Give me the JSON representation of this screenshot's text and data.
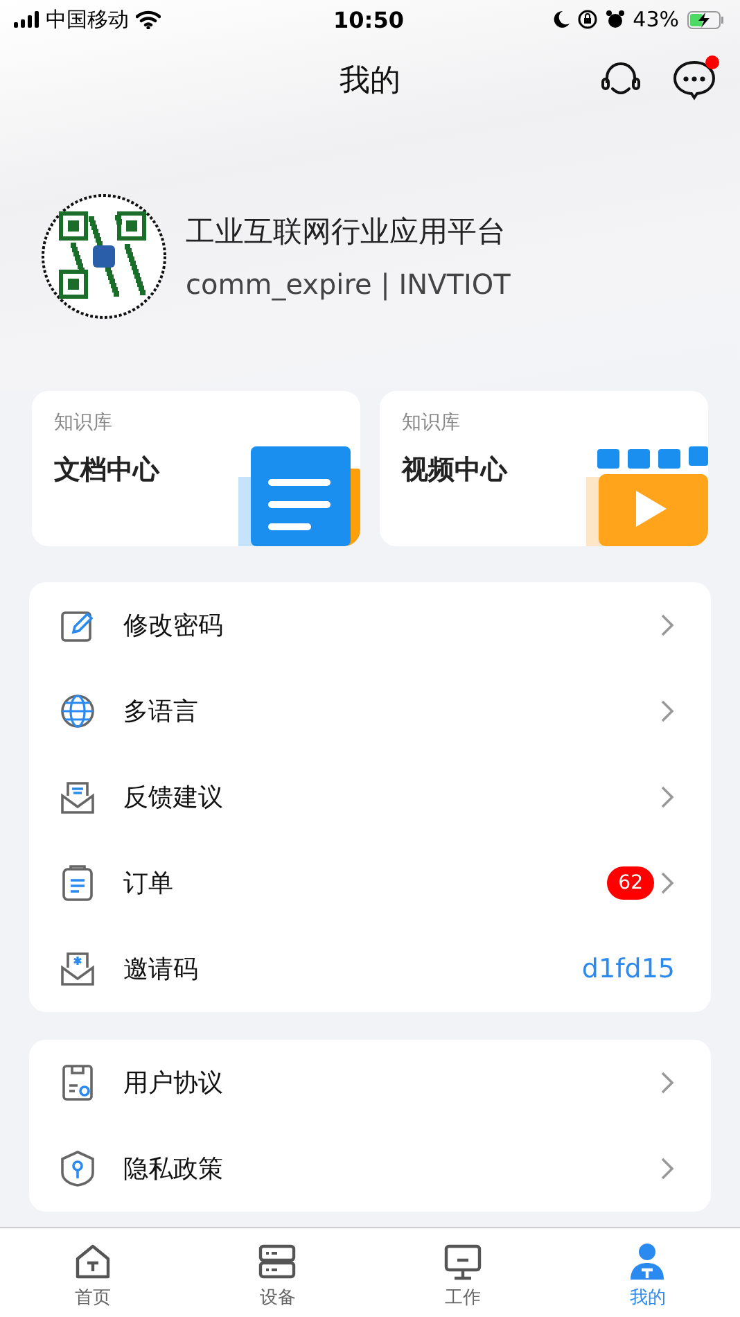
{
  "status_bar": {
    "carrier": "中国移动",
    "time": "10:50",
    "battery": "43%"
  },
  "header": {
    "title": "我的",
    "messages_unread": true
  },
  "profile": {
    "name": "工业互联网行业应用平台",
    "account": "comm_expire | INVTIOT"
  },
  "knowledge_cards": [
    {
      "category": "知识库",
      "title": "文档中心",
      "kind": "document"
    },
    {
      "category": "知识库",
      "title": "视频中心",
      "kind": "video"
    }
  ],
  "menu_groups": [
    [
      {
        "label": "修改密码",
        "kind": "edit"
      },
      {
        "label": "多语言",
        "kind": "globe"
      },
      {
        "label": "反馈建议",
        "kind": "inbox"
      },
      {
        "label": "订单",
        "kind": "list",
        "badge": "62"
      },
      {
        "label": "邀请码",
        "kind": "invite",
        "value": "d1fd15"
      }
    ],
    [
      {
        "label": "用户协议",
        "kind": "agreement"
      },
      {
        "label": "隐私政策",
        "kind": "privacy"
      }
    ]
  ],
  "tab_bar": [
    {
      "label": "首页",
      "selected": false
    },
    {
      "label": "设备",
      "selected": false
    },
    {
      "label": "工作",
      "selected": false
    },
    {
      "label": "我的",
      "selected": true
    }
  ]
}
